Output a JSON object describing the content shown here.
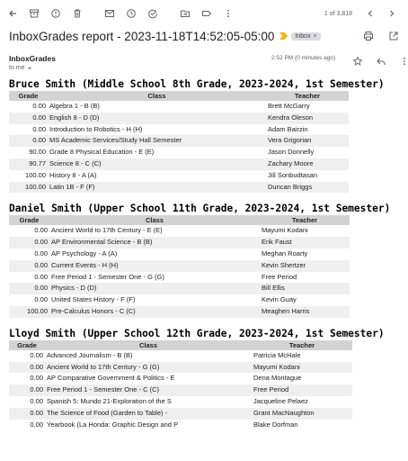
{
  "toolbar": {
    "pager": "1 of 3,818"
  },
  "message": {
    "subject": "InboxGrades report - 2023-11-18T14:52:05-05:00",
    "label": "Inbox",
    "sender": "InboxGrades",
    "recipient": "to me",
    "time": "2:52 PM (0 minutes ago)"
  },
  "colors": {
    "header_bg": "#d3d3d3",
    "alt_row_bg": "#efefef",
    "important": "#f4b400"
  },
  "table_headers": {
    "grade": "Grade",
    "class": "Class",
    "teacher": "Teacher"
  },
  "students": [
    {
      "heading": "Bruce Smith (Middle School 8th Grade, 2023-2024, 1st Semester)",
      "rows": [
        {
          "grade": "0.00",
          "class": "Algebra 1 - B (B)",
          "teacher": "Brett McGarry"
        },
        {
          "grade": "0.00",
          "class": "English 8 - D (D)",
          "teacher": "Kendra Oleson"
        },
        {
          "grade": "0.00",
          "class": "Introduction to Robotics - H (H)",
          "teacher": "Adam Bairzin"
        },
        {
          "grade": "0.00",
          "class": "MS Academic Services/Study Hall Semester",
          "teacher": "Vera Grigorian"
        },
        {
          "grade": "90.00",
          "class": "Grade 8 Physical Education - E (E)",
          "teacher": "Jason Donnelly"
        },
        {
          "grade": "90.77",
          "class": "Science 8 - C (C)",
          "teacher": "Zachary Moore"
        },
        {
          "grade": "100.00",
          "class": "History 8 - A (A)",
          "teacher": "Jill Sonbudtasan"
        },
        {
          "grade": "100.00",
          "class": "Latin 1B - F (F)",
          "teacher": "Duncan Briggs"
        }
      ]
    },
    {
      "heading": "Daniel Smith (Upper School 11th Grade, 2023-2024, 1st Semester)",
      "rows": [
        {
          "grade": "0.00",
          "class": "Ancient World to 17th Century - E (E)",
          "teacher": "Mayumi Kodani"
        },
        {
          "grade": "0.00",
          "class": "AP Environmental Science - B (B)",
          "teacher": "Erik Faust"
        },
        {
          "grade": "0.00",
          "class": "AP Psychology - A (A)",
          "teacher": "Meghan Roarty"
        },
        {
          "grade": "0.00",
          "class": "Current Events - H (H)",
          "teacher": "Kevin Shertzer"
        },
        {
          "grade": "0.00",
          "class": "Free Period 1 - Semester One - G (G)",
          "teacher": "Free Period"
        },
        {
          "grade": "0.00",
          "class": "Physics - D (D)",
          "teacher": "Bill Ellis"
        },
        {
          "grade": "0.00",
          "class": "United States History - F (F)",
          "teacher": "Kevin Guay"
        },
        {
          "grade": "100.00",
          "class": "Pre-Calculus Honors - C (C)",
          "teacher": "Meaghen Harris"
        }
      ]
    },
    {
      "heading": "Lloyd Smith (Upper School 12th Grade, 2023-2024, 1st Semester)",
      "rows": [
        {
          "grade": "0.00",
          "class": "Advanced Journalism - B (B)",
          "teacher": "Patricia McHale"
        },
        {
          "grade": "0.00",
          "class": "Ancient World to 17th Century - G (G)",
          "teacher": "Mayumi Kodani"
        },
        {
          "grade": "0.00",
          "class": "AP Comparative Government & Politics - E",
          "teacher": "Dena Montague"
        },
        {
          "grade": "0.00",
          "class": "Free Period 1 - Semester One - C (C)",
          "teacher": "Free Period"
        },
        {
          "grade": "0.00",
          "class": "Spanish 5: Mundo 21-Exploration of the S",
          "teacher": "Jacqueline Pelaez"
        },
        {
          "grade": "0.00",
          "class": "The Science of Food (Garden to Table) -",
          "teacher": "Grant MacNaughton"
        },
        {
          "grade": "0.00",
          "class": "Yearbook (La Honda: Graphic Design and P",
          "teacher": "Blake Dorfman"
        }
      ]
    }
  ]
}
